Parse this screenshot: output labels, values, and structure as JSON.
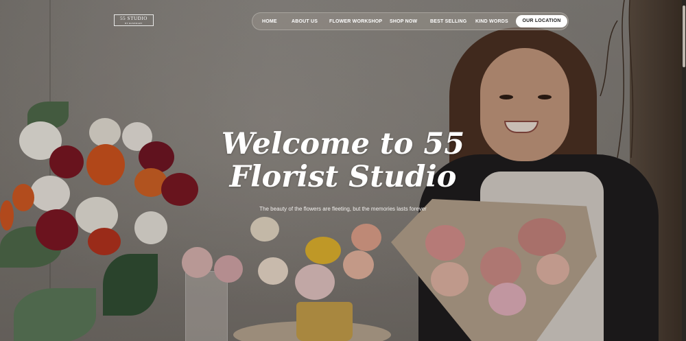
{
  "brand": {
    "logo_text": "55 STUDIO",
    "logo_subtext": "BY ROSEMARY"
  },
  "nav": {
    "items": [
      {
        "label": "HOME"
      },
      {
        "label": "ABOUT US"
      },
      {
        "label": "FLOWER WORKSHOP"
      },
      {
        "label": "SHOP NOW"
      },
      {
        "label": "BEST SELLING"
      },
      {
        "label": "KIND WORDS"
      }
    ],
    "cta_label": "OUR LOCATION"
  },
  "hero": {
    "title_line1": "Welcome to 55",
    "title_line2": "Florist Studio",
    "subtitle": "The beauty of the flowers are fleeting, but the memories lasts forever"
  },
  "colors": {
    "nav_text": "#ffffff",
    "cta_background": "#ffffff",
    "cta_text": "#222222",
    "hero_text": "#ffffff"
  }
}
